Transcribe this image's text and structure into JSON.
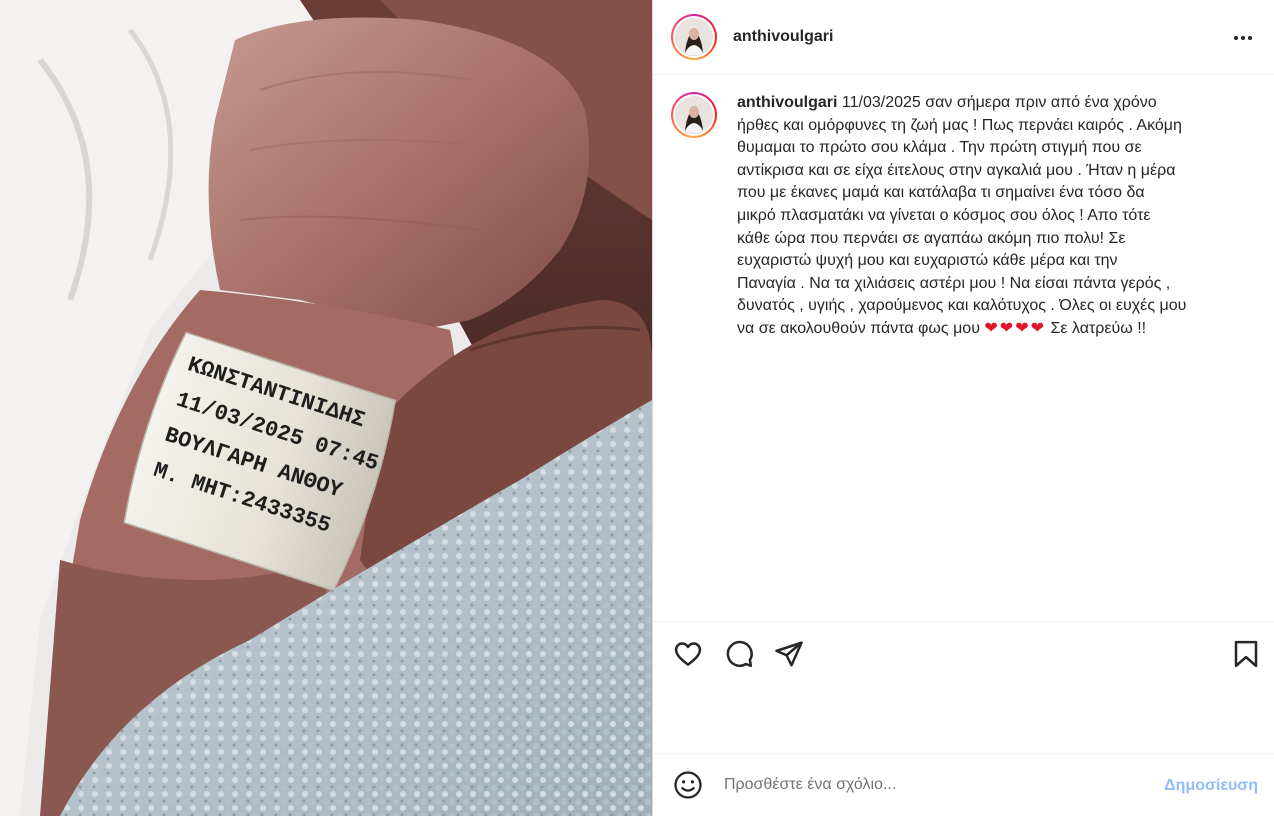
{
  "post": {
    "username": "anthivoulgari",
    "caption_user": "anthivoulgari",
    "caption_lines": [
      "11/03/2025 σαν σήμερα πριν από ένα χρόνο",
      "ήρθες και ομόρφυνες τη ζωή μας ! Πως περνάει καιρός . Ακόμη",
      "θυμαμαι το πρώτο σου κλάμα . Την πρώτη στιγμή που σε",
      "αντίκρισα και σε είχα έιτελους στην αγκαλιά μου . Ήταν η μέρα",
      "που με έκανες μαμά και κατάλαβα τι σημαίνει ένα τόσο δα",
      "μικρό πλασματάκι να γίνεται ο κόσμος σου όλος ! Απο τότε",
      "κάθε ώρα που περνάει σε αγαπάω ακόμη πιο πολυ! Σε",
      "ευχαριστώ ψυχή μου και ευχαριστώ κάθε μέρα και την",
      "Παναγία . Να τα χιλιάσεις αστέρι μου ! Να είσαι πάντα γερός ,",
      "δυνατός , υγιής , χαρούμενος και καλότυχος . Όλες οι ευχές μου"
    ],
    "caption_last_before": "να σε ακολουθούν πάντα φως μου",
    "caption_hearts": "❤❤❤❤",
    "caption_last_after": "Σε λατρεύω !!"
  },
  "photo": {
    "wristband_lines": [
      "ΚΩΝΣΤΑΝΤΙΝΙΔΗΣ",
      "11/03/2025 07:45",
      "ΒΟΥΛΓΑΡΗ ΑΝΘΟΥ",
      "Μ. ΜΗΤ:2433355"
    ]
  },
  "comment_box": {
    "placeholder": "Προσθέστε ένα σχόλιο...",
    "post_label": "Δημοσίευση"
  },
  "colors": {
    "accent_disabled": "#8fbef8",
    "heart": "#e0142a",
    "text": "#262626"
  },
  "icons": [
    "more-options-icon",
    "heart-icon",
    "comment-icon",
    "share-icon",
    "bookmark-icon",
    "emoji-icon"
  ]
}
